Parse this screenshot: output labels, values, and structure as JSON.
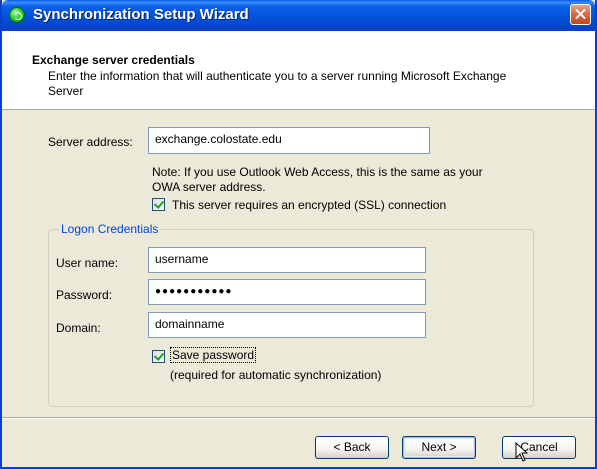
{
  "window": {
    "title": "Synchronization Setup Wizard"
  },
  "header": {
    "title": "Exchange server credentials",
    "description": "Enter the information that will authenticate you to a server running Microsoft Exchange Server"
  },
  "server": {
    "label": "Server address:",
    "value": "exchange.colostate.edu",
    "note": "Note: If you use Outlook Web Access, this is the same as your OWA server address.",
    "ssl_checkbox": {
      "label": "This server requires an encrypted (SSL) connection",
      "checked": true
    }
  },
  "logon": {
    "legend": "Logon Credentials",
    "username": {
      "label": "User name:",
      "value": "username"
    },
    "password": {
      "label": "Password:",
      "value": "●●●●●●●●●●●"
    },
    "domain": {
      "label": "Domain:",
      "value": "domainname"
    },
    "save_password": {
      "label": "Save password",
      "checked": true,
      "hint": "(required for automatic synchronization)"
    }
  },
  "buttons": {
    "back": "< Back",
    "next": "Next >",
    "cancel": "Cancel"
  },
  "icons": {
    "title_icon": "sync-wizard-icon",
    "close": "close-icon",
    "cursor": "mouse-pointer-icon"
  },
  "colors": {
    "titlebar": "#0453d8",
    "close_button": "#d96b46",
    "group_legend": "#0046d5",
    "checkmark": "#21a121"
  }
}
